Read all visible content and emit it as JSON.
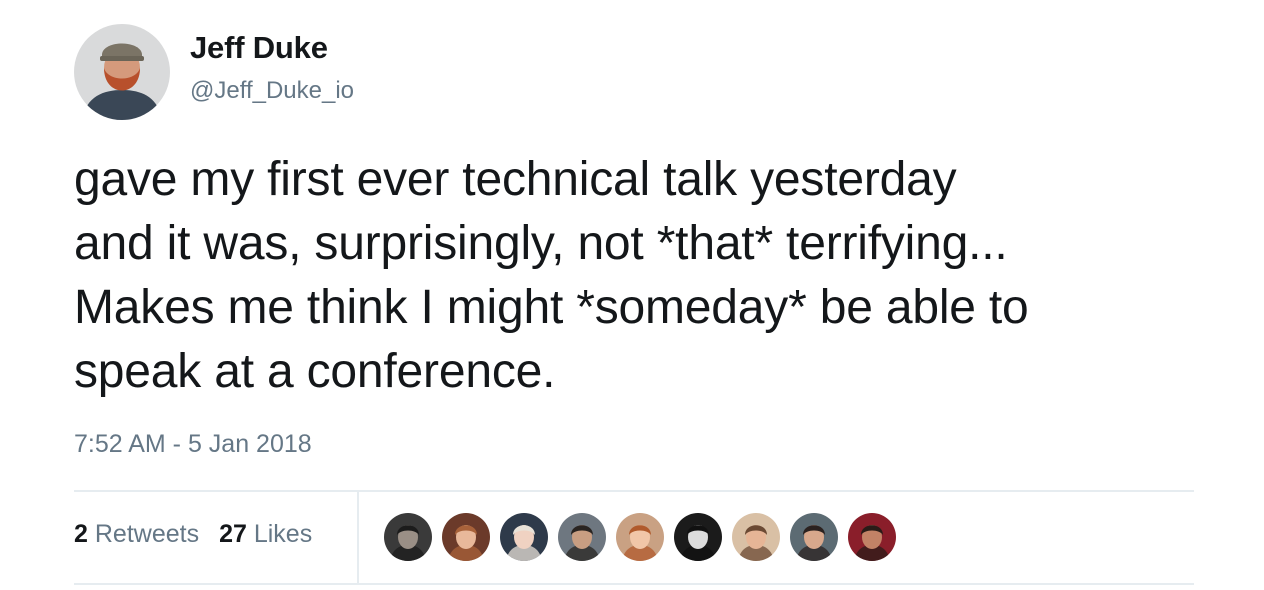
{
  "tweet": {
    "author_name": "Jeff Duke",
    "author_handle": "@Jeff_Duke_io",
    "text": "gave my first ever technical talk yesterday\nand it was, surprisingly, not *that* terrifying...\nMakes me think I might *someday* be able to\nspeak at a conference.",
    "timestamp": "7:52 AM - 5 Jan 2018"
  },
  "stats": {
    "retweets_count": "2",
    "retweets_label": "Retweets",
    "likes_count": "27",
    "likes_label": "Likes"
  },
  "likers": [
    {
      "name": "liker-avatar-1",
      "bg": "#3a3a3a",
      "skin": "#9a8f86",
      "hair": "#1c1c1c"
    },
    {
      "name": "liker-avatar-2",
      "bg": "#6b3a2a",
      "skin": "#e8b89a",
      "hair": "#a8623a"
    },
    {
      "name": "liker-avatar-3",
      "bg": "#2e3a4a",
      "skin": "#f0d2c2",
      "hair": "#e9e2d8"
    },
    {
      "name": "liker-avatar-4",
      "bg": "#6e7780",
      "skin": "#c89e82",
      "hair": "#2a2522"
    },
    {
      "name": "liker-avatar-5",
      "bg": "#c9a183",
      "skin": "#f1c6a8",
      "hair": "#b05a2c"
    },
    {
      "name": "liker-avatar-6",
      "bg": "#1b1b1b",
      "skin": "#dcdcdc",
      "hair": "#111111"
    },
    {
      "name": "liker-avatar-7",
      "bg": "#d9c0a5",
      "skin": "#e6b596",
      "hair": "#6b4a34"
    },
    {
      "name": "liker-avatar-8",
      "bg": "#5c6b73",
      "skin": "#d8a88c",
      "hair": "#2b2220"
    },
    {
      "name": "liker-avatar-9",
      "bg": "#8a1e2a",
      "skin": "#c28266",
      "hair": "#2a1c18"
    }
  ]
}
